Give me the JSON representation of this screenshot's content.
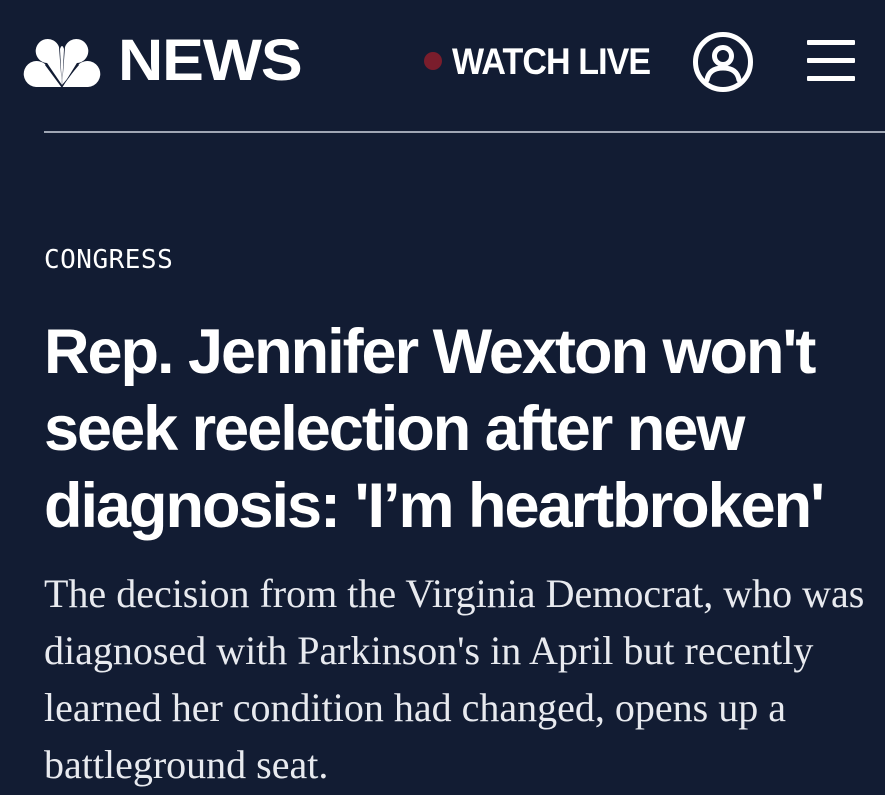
{
  "header": {
    "logo_text": "NEWS",
    "watch_live_label": "WATCH LIVE",
    "icons": {
      "logo": "nbc-peacock-icon",
      "live": "live-dot-icon",
      "account": "user-account-icon",
      "menu": "hamburger-menu-icon"
    }
  },
  "article": {
    "category": "CONGRESS",
    "headline": "Rep. Jennifer Wexton won't seek reelection after new diagnosis: 'I’m heartbroken'",
    "dek": "The decision from the Virginia Democrat, who was diagnosed with Parkinson's in April but recently learned her condition had changed, opens up a battleground seat."
  },
  "colors": {
    "background": "#121c33",
    "text": "#ffffff",
    "live_dot": "#7a1d2c",
    "divider": "#9fa6b4"
  }
}
